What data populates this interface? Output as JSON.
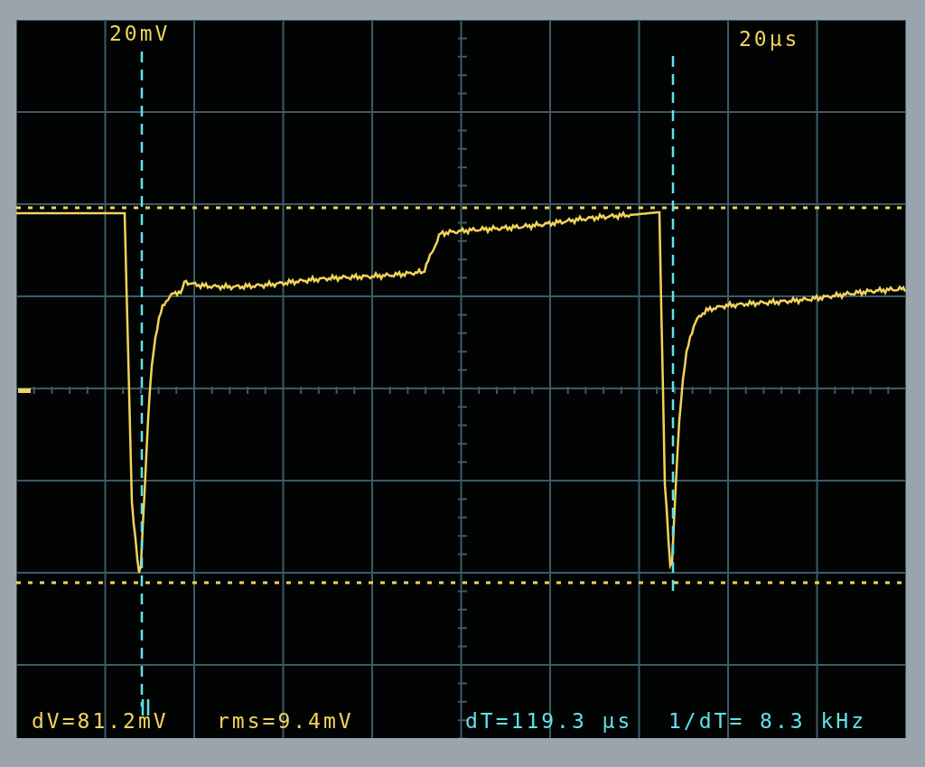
{
  "screen": {
    "channel_scale": {
      "text": "20mV",
      "color": "#f2d35a"
    },
    "time_scale": {
      "text": "20µs",
      "color": "#f2d35a"
    },
    "readouts": [
      {
        "text": "dV=81.2mV",
        "color": "#f2d35a"
      },
      {
        "text": "rms=9.4mV",
        "color": "#f2d35a"
      },
      {
        "text": "dT=119.3 µs",
        "color": "#5fe3ea"
      },
      {
        "text": "1/dT= 8.3 kHz",
        "color": "#5fe3ea"
      }
    ]
  }
}
